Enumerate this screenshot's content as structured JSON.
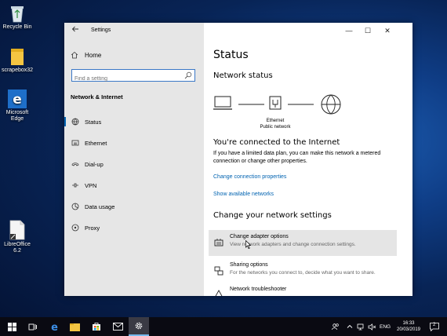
{
  "desktop": {
    "icons": [
      {
        "label": "Recycle Bin"
      },
      {
        "label": "scrapebox32"
      },
      {
        "label": "Microsoft Edge"
      },
      {
        "label": "LibreOffice 6.2"
      }
    ]
  },
  "window": {
    "title": "Settings",
    "controls": {
      "minimize": "—",
      "maximize": "☐",
      "close": "✕"
    }
  },
  "sidebar": {
    "home_label": "Home",
    "search_placeholder": "Find a setting",
    "section_label": "Network & Internet",
    "items": [
      {
        "label": "Status",
        "icon": "globe-icon",
        "active": true
      },
      {
        "label": "Ethernet",
        "icon": "ethernet-icon"
      },
      {
        "label": "Dial-up",
        "icon": "dialup-icon"
      },
      {
        "label": "VPN",
        "icon": "vpn-icon"
      },
      {
        "label": "Data usage",
        "icon": "data-usage-icon"
      },
      {
        "label": "Proxy",
        "icon": "proxy-icon"
      }
    ]
  },
  "main": {
    "title": "Status",
    "network_status_heading": "Network status",
    "diagram": {
      "adapter_name": "Ethernet",
      "network_type": "Public network"
    },
    "connected_heading": "You're connected to the Internet",
    "connected_text": "If you have a limited data plan, you can make this network a metered connection or change other properties.",
    "link_change_props": "Change connection properties",
    "link_show_networks": "Show available networks",
    "change_settings_heading": "Change your network settings",
    "options": [
      {
        "title": "Change adapter options",
        "desc": "View network adapters and change connection settings.",
        "icon": "adapter-icon"
      },
      {
        "title": "Sharing options",
        "desc": "For the networks you connect to, decide what you want to share.",
        "icon": "sharing-icon"
      },
      {
        "title": "Network troubleshooter",
        "desc": "",
        "icon": "troubleshooter-icon"
      }
    ]
  },
  "taskbar": {
    "language": "ENG",
    "time": "16:33",
    "date": "20/03/2019",
    "notification_count": "2"
  },
  "colors": {
    "accent": "#0063b1",
    "sidebar_bg": "#e6e6e6",
    "taskbar_bg": "#0a0a12"
  }
}
